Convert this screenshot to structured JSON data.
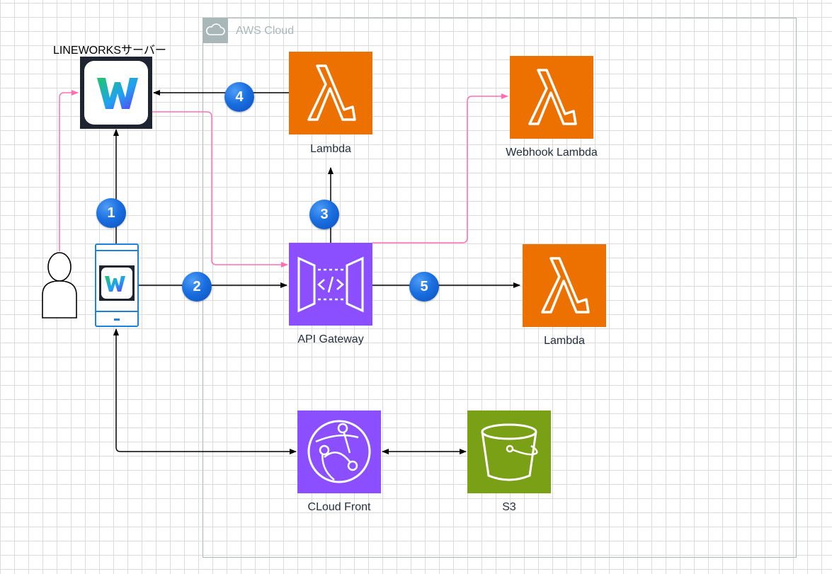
{
  "cloud": {
    "title": "AWS Cloud"
  },
  "nodes": {
    "lineworks_server": {
      "label": "LINEWORKSサーバー"
    },
    "lambda_top": {
      "label": "Lambda"
    },
    "webhook_lambda": {
      "label": "Webhook Lambda"
    },
    "api_gateway": {
      "label": "API Gateway"
    },
    "lambda_right": {
      "label": "Lambda"
    },
    "cloudfront": {
      "label": "CLoud Front"
    },
    "s3": {
      "label": "S3"
    }
  },
  "steps": [
    "1",
    "2",
    "3",
    "4",
    "5"
  ],
  "colors": {
    "lambda": "#ed7100",
    "apigw": "#8c4fff",
    "s3": "#7aa116",
    "step_badge": "#1a6fe0",
    "pink_flow": "#ff6eb4"
  }
}
